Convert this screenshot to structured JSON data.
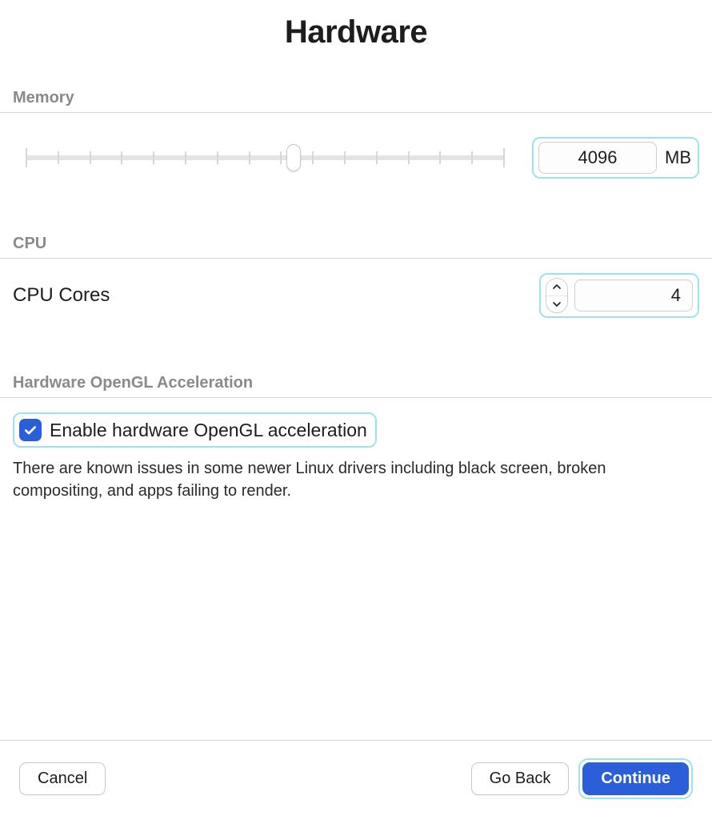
{
  "title": "Hardware",
  "memory": {
    "section_label": "Memory",
    "value": "4096",
    "unit": "MB"
  },
  "cpu": {
    "section_label": "CPU",
    "row_label": "CPU Cores",
    "value": "4"
  },
  "opengl": {
    "section_label": "Hardware OpenGL Acceleration",
    "checkbox_label": "Enable hardware OpenGL acceleration",
    "checked": true,
    "note": "There are known issues in some newer Linux drivers including black screen, broken compositing, and apps failing to render."
  },
  "footer": {
    "cancel": "Cancel",
    "back": "Go Back",
    "continue": "Continue"
  }
}
